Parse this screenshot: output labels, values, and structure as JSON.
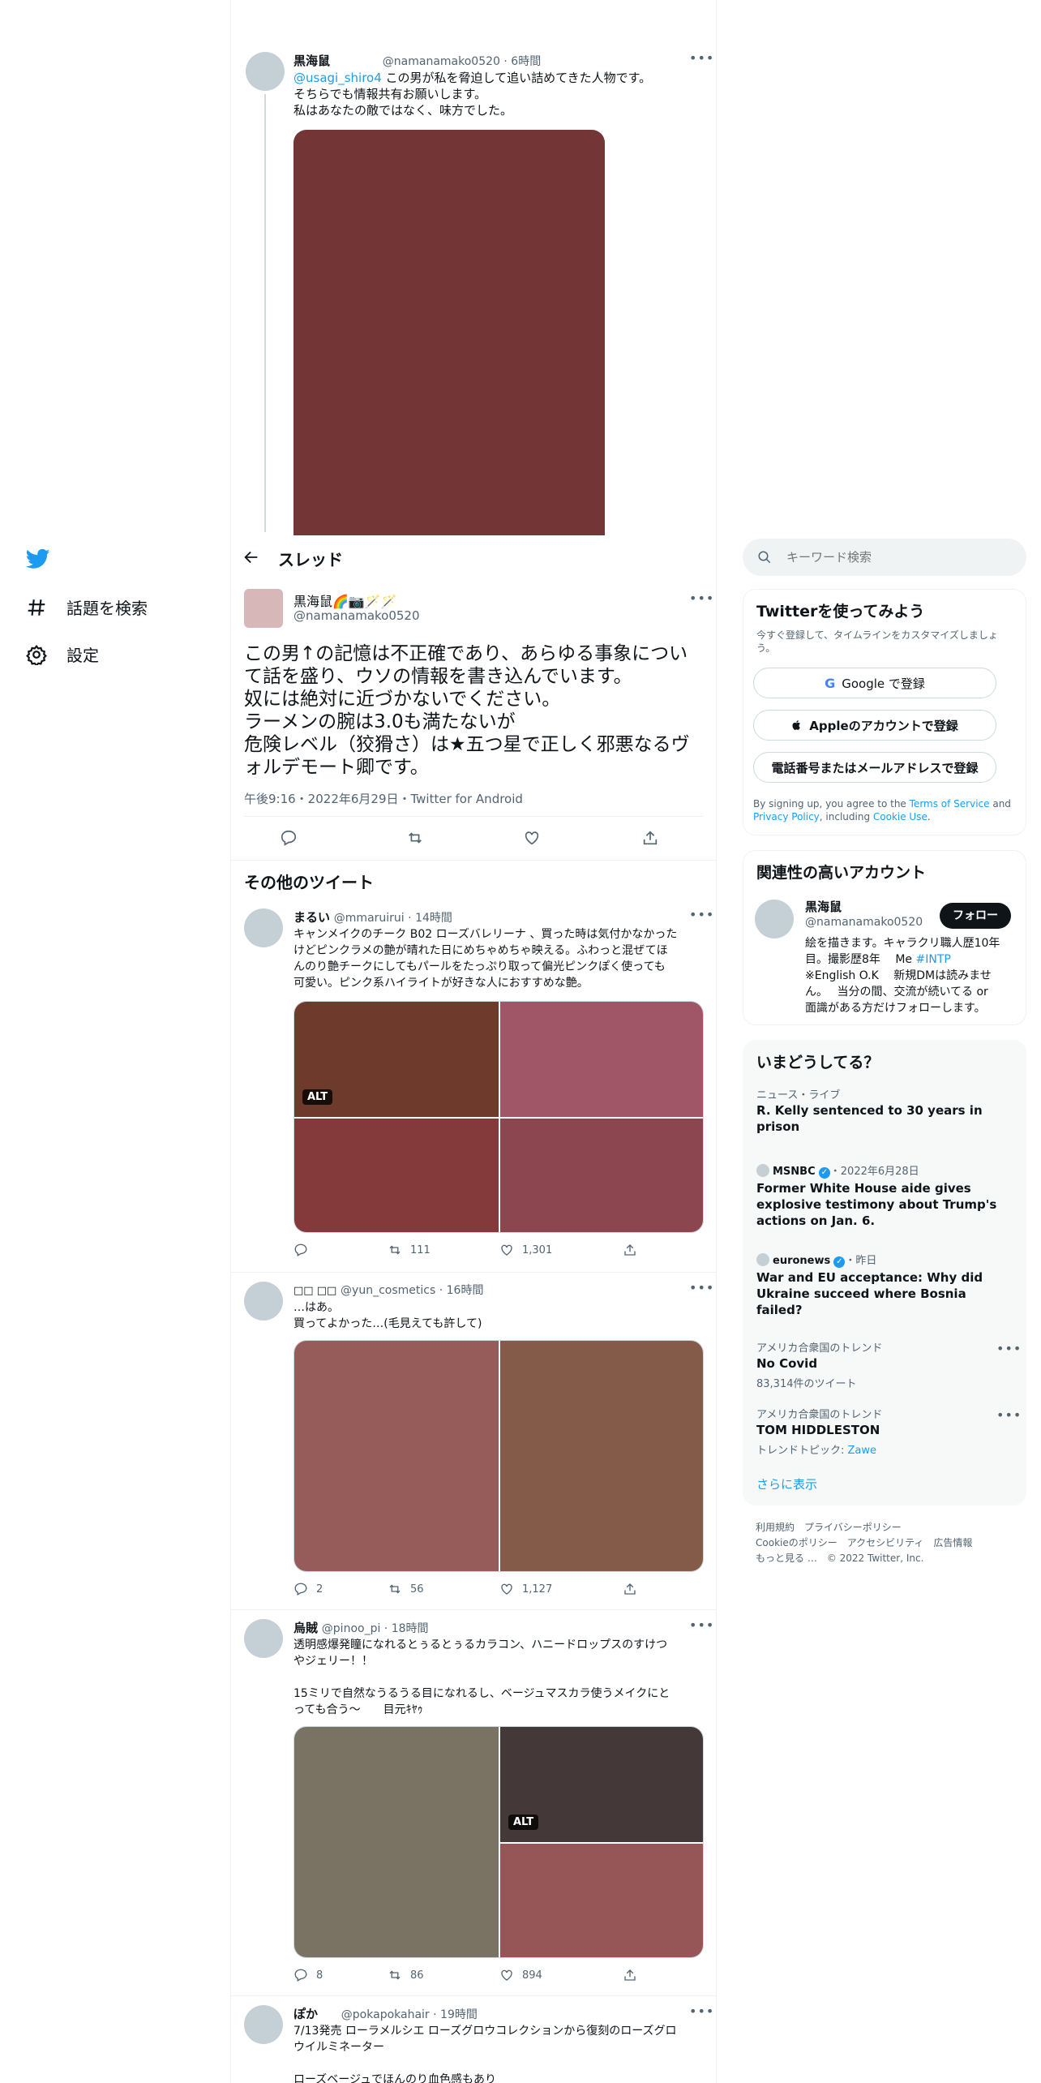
{
  "nav": {
    "explore_label": "話題を検索",
    "settings_label": "設定"
  },
  "thread_header": {
    "title": "スレッド"
  },
  "context_tweet": {
    "name": "黒海鼠",
    "handle": "@namanamako0520",
    "time": "6時間",
    "mention": "@usagi_shiro4",
    "line1": " この男が私を脅迫して追い詰めてきた人物です。",
    "line2": "そちらでも情報共有お願いします。",
    "line3": "私はあなたの敵ではなく、味方でした。",
    "media_color": "#733536"
  },
  "main_tweet": {
    "name": "黒海鼠🌈📷🪄🪄",
    "handle": "@namanamako0520",
    "text_lines": [
      "この男↑の記憶は不正確であり、あらゆる事象につい",
      "て話を盛り、ウソの情報を書き込んでいます。",
      "奴には絶対に近づかないでください。",
      "ラーメンの腕は3.0も満たないが",
      "危険レベル（狡猾さ）は★五つ星で正しく邪悪なるヴ",
      "ォルデモート卿です。"
    ],
    "meta": "午後9:16・2022年6月29日・Twitter for Android"
  },
  "more_tweets_title": "その他のツイート",
  "tweets": [
    {
      "name": "まるい",
      "handle": "@mmaruirui",
      "time": "14時間",
      "lines": [
        "キャンメイクのチーク B02 ローズバレリーナ 、買った時は気付かなかった",
        "けどピンクラメの艶が晴れた日にめちゃめちゃ映える。ふわっと混ぜてほ",
        "んのり艶チークにしてもパールをたっぷり取って偏光ピンクぽく使っても",
        "可愛い。ピンク系ハイライトが好きな人におすすめな艶。"
      ],
      "media_colors": [
        "#6e3a2c",
        "#a15667",
        "#843a3a",
        "#8b4650"
      ],
      "alt_label": "ALT",
      "reply": "",
      "retweet": "111",
      "like": "1,301"
    },
    {
      "name": "□□ □□",
      "handle": "@yun_cosmetics",
      "time": "16時間",
      "lines": [
        "…はあ。",
        "買ってよかった…(毛見えても許して)"
      ],
      "media_colors": [
        "#955c59",
        "#845a48"
      ],
      "reply": "2",
      "retweet": "56",
      "like": "1,127"
    },
    {
      "name": "烏賊",
      "handle": "@pinoo_pi",
      "time": "18時間",
      "lines": [
        "透明感爆発瞳になれるとぅるとぅるカラコン、ハニードロップスのすけつ",
        "やジェリー！！",
        "",
        "15ミリで自然なうるうる目になれるし、ベージュマスカラ使うメイクにと",
        "っても合う〜　　目元ｷﾔｩ"
      ],
      "media_colors": [
        "#7a7363",
        "#453838",
        "#965556"
      ],
      "alt_label": "ALT",
      "reply": "8",
      "retweet": "86",
      "like": "894"
    },
    {
      "name": "ぽか",
      "handle": "@pokapokahair",
      "time": "19時間",
      "lines": [
        "7/13発売 ローラメルシエ ローズグロウコレクションから復刻のローズグロ",
        "ウイルミネーター",
        "",
        "ローズベージュでほんのり血色感もあり"
      ]
    }
  ],
  "search": {
    "placeholder": "キーワード検索"
  },
  "signup": {
    "title": "Twitterを使ってみよう",
    "subtitle_1": "今すぐ登録して、タイムラインをカスタマイズしましょ",
    "subtitle_2": "う。",
    "google_label": "Google で登録",
    "apple_label": "Appleのアカウントで登録",
    "phone_label": "電話番号またはメールアドレスで登録",
    "legal_1": "By signing up, you agree to the ",
    "tos": "Terms of Service",
    "legal_2": " and",
    "privacy": "Privacy Policy",
    "legal_3": ", including ",
    "cookie": "Cookie Use",
    "legal_4": "."
  },
  "related": {
    "title": "関連性の高いアカウント",
    "name": "黒海鼠",
    "handle": "@namanamako0520",
    "follow_label": "フォロー",
    "bio_1": "絵を描きます。キャラクリ職人歴10年",
    "bio_2a": "目。撮影歴8年　 Me ",
    "bio_2b": "#INTP",
    "bio_3": "※English O.K　 新規DMは読みませ",
    "bio_4": "ん。　 当分の間、交流が続いてる or",
    "bio_5": "面識がある方だけフォローします。"
  },
  "trends": {
    "title": "いまどうしてる？",
    "items": [
      {
        "meta": "ニュース・ライブ",
        "title_1": "R. Kelly sentenced to 30 years in",
        "title_2": "prison"
      },
      {
        "source": "MSNBC",
        "meta": "・2022年6月28日",
        "title_1": "Former White House aide gives",
        "title_2": "explosive testimony about Trump's",
        "title_3": "actions on Jan. 6."
      },
      {
        "source": "euronews",
        "meta": "・昨日",
        "title_1": "War and EU acceptance: Why did",
        "title_2": "Ukraine succeed where Bosnia",
        "title_3": "failed?"
      },
      {
        "meta": "アメリカ合衆国のトレンド",
        "title_1": "No Covid",
        "sub": "83,314件のツイート"
      },
      {
        "meta": "アメリカ合衆国のトレンド",
        "title_1": "TOM HIDDLESTON",
        "sub": "トレンドトピック: ",
        "sub_link": "Zawe"
      }
    ],
    "show_more": "さらに表示"
  },
  "footer": {
    "line_1": "利用規約　プライバシーポリシー",
    "line_2": "Cookieのポリシー　アクセシビリティ　広告情報",
    "line_3": "もっと見る …　© 2022 Twitter, Inc."
  }
}
